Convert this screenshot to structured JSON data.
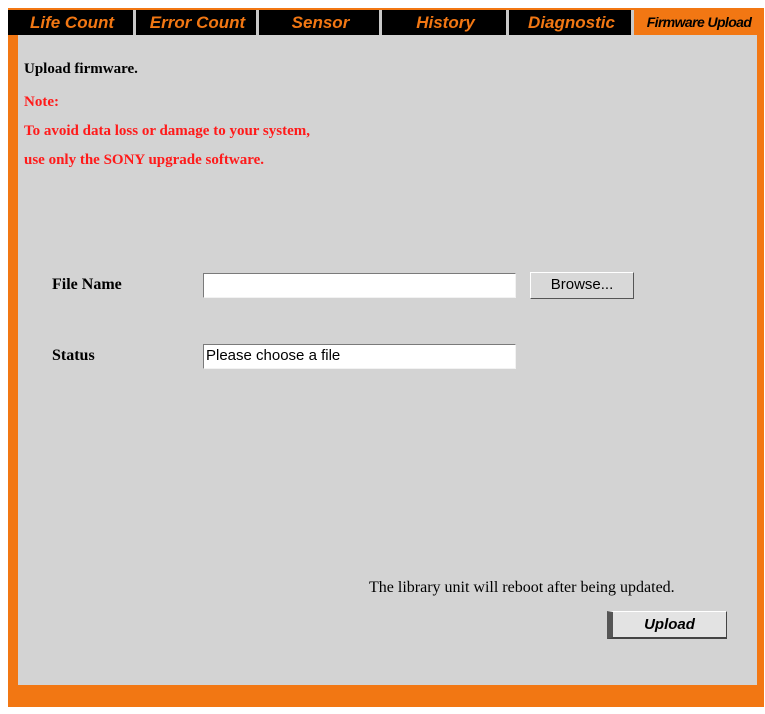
{
  "tabs": [
    {
      "label": "Life Count"
    },
    {
      "label": "Error Count"
    },
    {
      "label": "Sensor"
    },
    {
      "label": "History"
    },
    {
      "label": "Diagnostic"
    },
    {
      "label": "Firmware Upload",
      "active": true
    }
  ],
  "main": {
    "heading": "Upload firmware.",
    "note_title": "Note:",
    "note_line1": "To avoid data loss or damage to your system,",
    "note_line2": "use only the SONY upgrade software.",
    "file_name_label": "File Name",
    "file_name_value": "",
    "browse_label": "Browse...",
    "status_label": "Status",
    "status_value": "Please choose a file",
    "reboot_notice": "The library unit will reboot after being updated.",
    "upload_label": "Upload"
  },
  "colors": {
    "accent": "#f27713",
    "tab_bg": "#000000",
    "panel_bg": "#d3d3d3",
    "note_text": "#ff1a1a"
  }
}
